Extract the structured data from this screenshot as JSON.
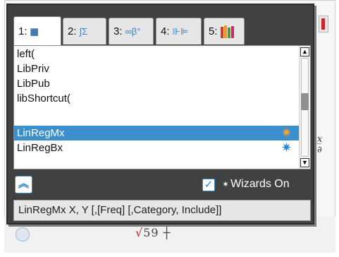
{
  "tabs": [
    {
      "number": "1:",
      "icon": "catalog-book-icon",
      "glyph": "▦"
    },
    {
      "number": "2:",
      "icon": "math-templates-icon",
      "glyph": "∫Σ"
    },
    {
      "number": "3:",
      "icon": "symbols-icon",
      "glyph": "∞β°"
    },
    {
      "number": "4:",
      "icon": "units-icon",
      "glyph": "⊪⊫"
    },
    {
      "number": "5:",
      "icon": "libraries-icon",
      "glyph": ""
    }
  ],
  "list": {
    "items": [
      {
        "label": "left("
      },
      {
        "label": "LibPriv"
      },
      {
        "label": "LibPub"
      },
      {
        "label": "libShortcut("
      },
      {
        "label": "LinRegMx",
        "selected": true,
        "wizard_icon": "✷"
      },
      {
        "label": "LinRegBx",
        "wizard_icon": "✷"
      }
    ],
    "scroll_up_glyph": "▲",
    "scroll_down_glyph": "▼"
  },
  "footer": {
    "collapse_glyph": "︽",
    "wizards_checked": true,
    "checkbox_glyph": "✓",
    "wizard_prefix": "✶",
    "wizards_label": "Wizards On"
  },
  "syntax_help": "LinRegMx X, Y [,[Freq] [,Category, Include]]",
  "background": {
    "formula_fragment_red": "√",
    "formula_fragment": "59 ┼",
    "right_edge_text": "x̲\n∂"
  },
  "colors": {
    "selection": "#3a8fcc",
    "popup_bg": "#414141",
    "accent": "#2a84d0",
    "wizard_selected": "#f2a33a"
  }
}
